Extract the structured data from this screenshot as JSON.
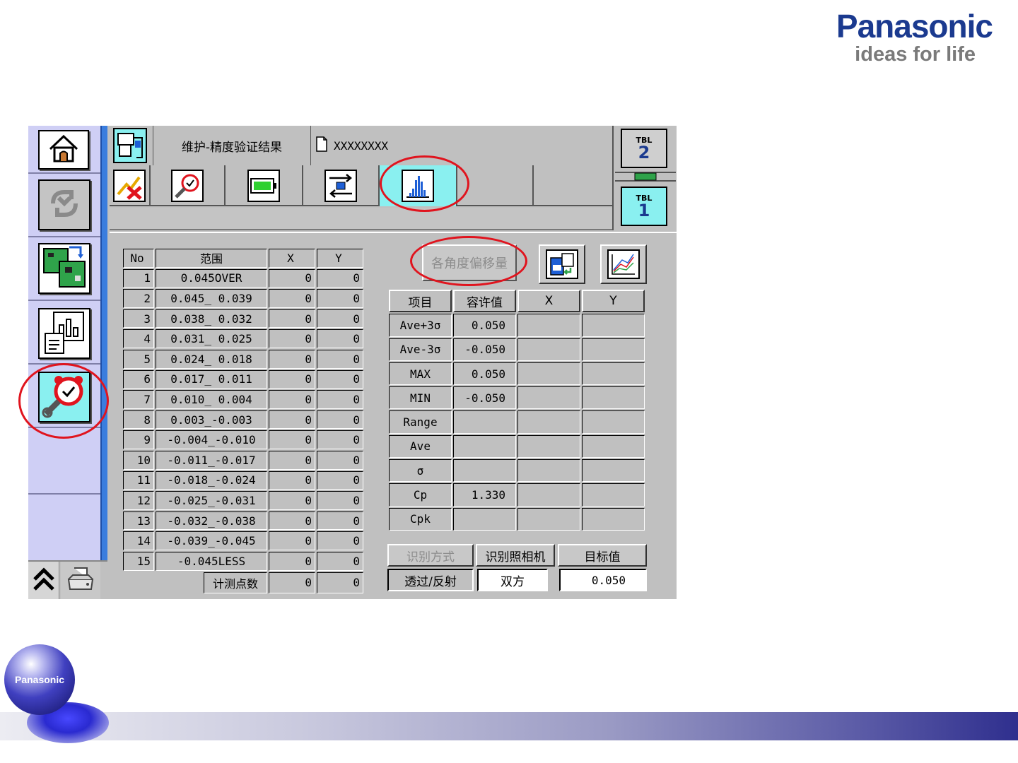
{
  "brand": {
    "name": "Panasonic",
    "tagline": "ideas for life"
  },
  "header": {
    "title": "维护-精度验证结果",
    "file_name": "XXXXXXXX"
  },
  "tables": {
    "tbl2": {
      "label": "TBL",
      "number": "2"
    },
    "tbl1": {
      "label": "TBL",
      "number": "1"
    }
  },
  "range_table": {
    "headers": {
      "no": "No",
      "range": "范围",
      "x": "X",
      "y": "Y"
    },
    "rows": [
      {
        "no": "1",
        "range": "0.045OVER",
        "x": "0",
        "y": "0"
      },
      {
        "no": "2",
        "range": "0.045_ 0.039",
        "x": "0",
        "y": "0"
      },
      {
        "no": "3",
        "range": "0.038_ 0.032",
        "x": "0",
        "y": "0"
      },
      {
        "no": "4",
        "range": "0.031_ 0.025",
        "x": "0",
        "y": "0"
      },
      {
        "no": "5",
        "range": "0.024_ 0.018",
        "x": "0",
        "y": "0"
      },
      {
        "no": "6",
        "range": "0.017_ 0.011",
        "x": "0",
        "y": "0"
      },
      {
        "no": "7",
        "range": "0.010_ 0.004",
        "x": "0",
        "y": "0"
      },
      {
        "no": "8",
        "range": "0.003_-0.003",
        "x": "0",
        "y": "0"
      },
      {
        "no": "9",
        "range": "-0.004_-0.010",
        "x": "0",
        "y": "0"
      },
      {
        "no": "10",
        "range": "-0.011_-0.017",
        "x": "0",
        "y": "0"
      },
      {
        "no": "11",
        "range": "-0.018_-0.024",
        "x": "0",
        "y": "0"
      },
      {
        "no": "12",
        "range": "-0.025_-0.031",
        "x": "0",
        "y": "0"
      },
      {
        "no": "13",
        "range": "-0.032_-0.038",
        "x": "0",
        "y": "0"
      },
      {
        "no": "14",
        "range": "-0.039_-0.045",
        "x": "0",
        "y": "0"
      },
      {
        "no": "15",
        "range": "-0.045LESS",
        "x": "0",
        "y": "0"
      }
    ],
    "count": {
      "label": "计测点数",
      "x": "0",
      "y": "0"
    }
  },
  "angle_button": "各角度偏移量",
  "stats_table": {
    "headers": {
      "item": "项目",
      "tolerance": "容许值",
      "x": "X",
      "y": "Y"
    },
    "rows": [
      {
        "item": "Ave+3σ",
        "tolerance": "0.050",
        "x": "",
        "y": ""
      },
      {
        "item": "Ave-3σ",
        "tolerance": "-0.050",
        "x": "",
        "y": ""
      },
      {
        "item": "MAX",
        "tolerance": "0.050",
        "x": "",
        "y": ""
      },
      {
        "item": "MIN",
        "tolerance": "-0.050",
        "x": "",
        "y": ""
      },
      {
        "item": "Range",
        "tolerance": "",
        "x": "",
        "y": ""
      },
      {
        "item": "Ave",
        "tolerance": "",
        "x": "",
        "y": ""
      },
      {
        "item": "σ",
        "tolerance": "",
        "x": "",
        "y": ""
      },
      {
        "item": "Cp",
        "tolerance": "1.330",
        "x": "",
        "y": ""
      },
      {
        "item": "Cpk",
        "tolerance": "",
        "x": "",
        "y": ""
      }
    ]
  },
  "options": {
    "recognition_method_label": "识别方式",
    "recognition_method_value": "透过/反射",
    "camera_label": "识别照相机",
    "camera_value": "双方",
    "target_label": "目标值",
    "target_value": "0.050"
  },
  "footer": {
    "globe_label": "Panasonic"
  },
  "colors": {
    "active": "#8af0f0",
    "annotation": "#e0141e",
    "brand": "#1b3a8f"
  },
  "icons": {
    "sidebar": [
      "home-icon",
      "recycle-icon",
      "board-transfer-icon",
      "report-chart-icon",
      "maintenance-clock-icon"
    ],
    "toolbar": [
      "error-reset-icon",
      "maintenance-clock-icon",
      "battery-icon",
      "transfer-icon",
      "histogram-icon"
    ]
  }
}
